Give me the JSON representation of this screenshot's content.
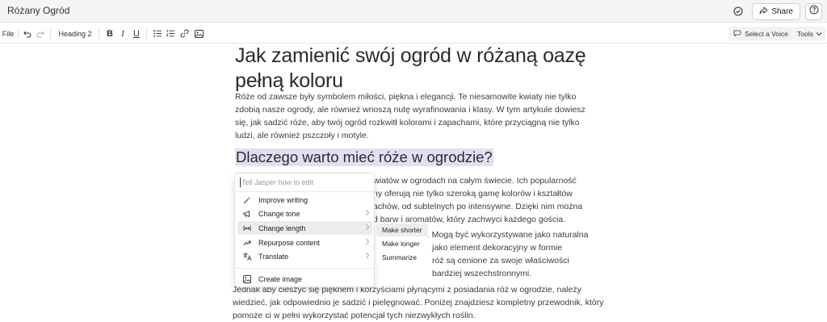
{
  "titlebar": {
    "doc_title": "Różany Ogród",
    "share_label": "Share",
    "icons": [
      "check-circle-icon",
      "share-icon",
      "help-icon"
    ]
  },
  "toolbar": {
    "file_label": "File",
    "heading_label": "Heading 2",
    "bold": "B",
    "italic": "I",
    "underline": "U",
    "voice_label": "Select a Voice",
    "tools_label": "Tools"
  },
  "document": {
    "title": "Jak zamienić swój ogród w różaną oazę pełną koloru",
    "intro": "Róże od zawsze były symbolem miłości, piękna i elegancji. Te niesamowite kwiaty nie tylko zdobią nasze ogrody, ale również wnoszą nutę wyrafinowania i klasy. W tym artykule dowiesz się, jak sadzić róże, aby twój ogród rozkwitł kolorami i zapachami, które przyciągną nie tylko ludzi, ale również pszczoły i motyle.",
    "section_heading": "Dlaczego warto mieć róże w ogrodzie?",
    "para2_lines": [
      "ch kwiatów w ogrodach na całym świecie. Ich popularność",
      "ny oferują nie tylko szeroką gamę kolorów i kształtów",
      "achów, od subtelnych po intensywne. Dzięki nim można",
      "d barw i aromatów, który zachwyci każdego gościa."
    ],
    "para3_lines": [
      "e. Mogą być wykorzystywane jako naturalna",
      "jako element dekoracyjny w formie",
      "róż są cenione za swoje właściwości",
      "bardziej wszechstronnymi."
    ],
    "para4_lines": [
      "Jednak aby cieszyć się pięknem i korzyściami płynącymi z posiadania róż w ogrodzie, należy",
      "wiedzieć, jak odpowiednio je sadzić i pielęgnować. Poniżej znajdziesz kompletny przewodnik, który",
      "pomoże ci w pełni wykorzystać potencjał tych niezwykłych roślin."
    ]
  },
  "ai_menu": {
    "placeholder": "Tell Jasper how to edit",
    "items": [
      {
        "label": "Improve writing",
        "icon": "magic-wand-icon"
      },
      {
        "label": "Change tone",
        "icon": "megaphone-icon"
      },
      {
        "label": "Change length",
        "icon": "resize-horizontal-icon"
      },
      {
        "label": "Repurpose content",
        "icon": "trend-arrow-icon"
      },
      {
        "label": "Translate",
        "icon": "translate-icon"
      },
      {
        "label": "Create image",
        "icon": "image-icon"
      }
    ],
    "submenu": [
      "Make shorter",
      "Make longer",
      "Summarize"
    ]
  },
  "colors": {
    "highlight": "#e1dff4",
    "hover": "#ececec",
    "titlebar_bg": "#f5f5f4"
  }
}
